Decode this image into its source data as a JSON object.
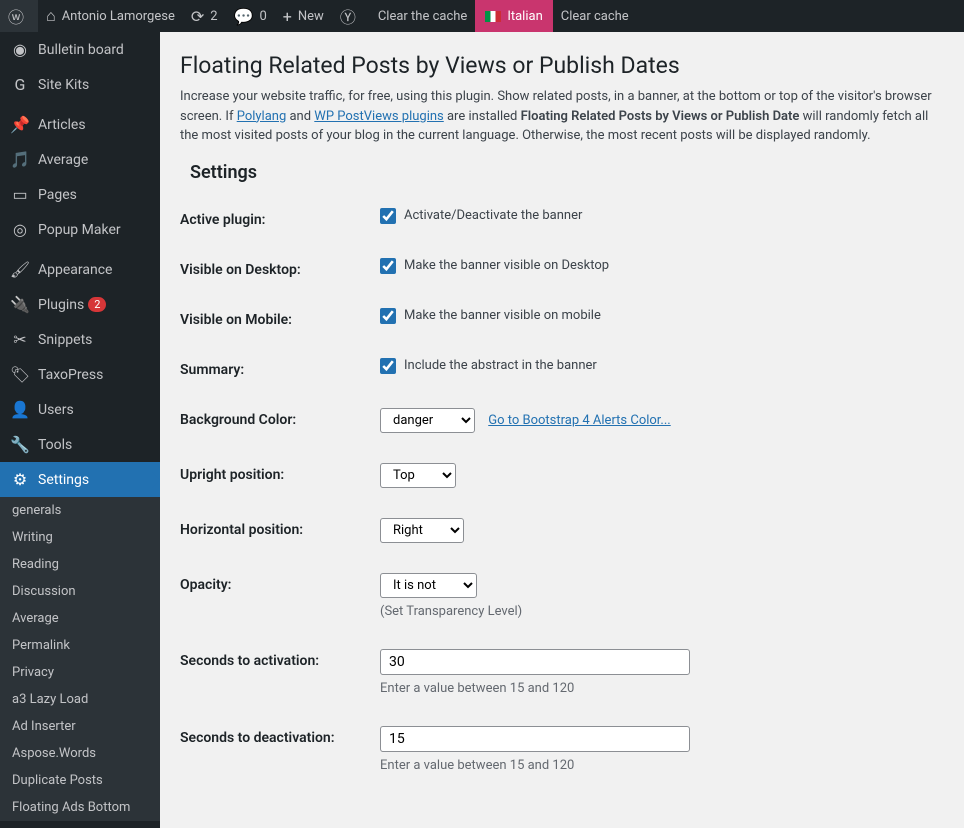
{
  "toolbar": {
    "site_name": "Antonio Lamorgese",
    "refresh_count": "2",
    "comments_count": "0",
    "new_label": "New",
    "clear_cache_label": "Clear the cache",
    "italian_label": "Italian",
    "clear_cache2_label": "Clear cache"
  },
  "sidebar": {
    "items": [
      {
        "label": "Bulletin board",
        "icon": "speed"
      },
      {
        "label": "Site Kits",
        "icon": "g"
      },
      {
        "label": "Articles",
        "icon": "pin"
      },
      {
        "label": "Average",
        "icon": "media"
      },
      {
        "label": "Pages",
        "icon": "pages"
      },
      {
        "label": "Popup Maker",
        "icon": "target"
      },
      {
        "label": "Appearance",
        "icon": "brush"
      },
      {
        "label": "Plugins",
        "icon": "plug",
        "badge": "2"
      },
      {
        "label": "Snippets",
        "icon": "scissors"
      },
      {
        "label": "TaxoPress",
        "icon": "tag"
      },
      {
        "label": "Users",
        "icon": "user"
      },
      {
        "label": "Tools",
        "icon": "wrench"
      },
      {
        "label": "Settings",
        "icon": "sliders",
        "active": true
      }
    ],
    "submenu": [
      "generals",
      "Writing",
      "Reading",
      "Discussion",
      "Average",
      "Permalink",
      "Privacy",
      "a3 Lazy Load",
      "Ad Inserter",
      "Aspose.Words",
      "Duplicate Posts",
      "Floating Ads Bottom"
    ]
  },
  "page": {
    "title": "Floating Related Posts by Views or Publish Dates",
    "desc_1": "Increase your website traffic, for free, using this plugin. Show related posts, in a banner, at the bottom or top of the visitor's browser screen. If ",
    "polylang": "Polylang",
    "desc_and": " and ",
    "wp_postviews": "WP PostViews plugins",
    "desc_2": " are installed ",
    "strong": "Floating Related Posts by Views or Publish Date",
    "desc_3": " will randomly fetch all the most visited posts of your blog in the current language. Otherwise, the most recent posts will be displayed randomly.",
    "settings_heading": "Settings"
  },
  "form": {
    "active_plugin": {
      "label": "Active plugin:",
      "text": "Activate/Deactivate the banner"
    },
    "visible_desktop": {
      "label": "Visible on Desktop:",
      "text": "Make the banner visible on Desktop"
    },
    "visible_mobile": {
      "label": "Visible on Mobile:",
      "text": "Make the banner visible on mobile"
    },
    "summary": {
      "label": "Summary:",
      "text": "Include the abstract in the banner"
    },
    "bg_color": {
      "label": "Background Color:",
      "value": "danger",
      "link": "Go to Bootstrap 4 Alerts Color..."
    },
    "upright": {
      "label": "Upright position:",
      "value": "Top"
    },
    "horizontal": {
      "label": "Horizontal position:",
      "value": "Right"
    },
    "opacity": {
      "label": "Opacity:",
      "value": "It is not",
      "help": "(Set Transparency Level)"
    },
    "seconds_activation": {
      "label": "Seconds to activation:",
      "value": "30",
      "help": "Enter a value between 15 and 120"
    },
    "seconds_deactivation": {
      "label": "Seconds to deactivation:",
      "value": "15",
      "help": "Enter a value between 15 and 120"
    }
  }
}
